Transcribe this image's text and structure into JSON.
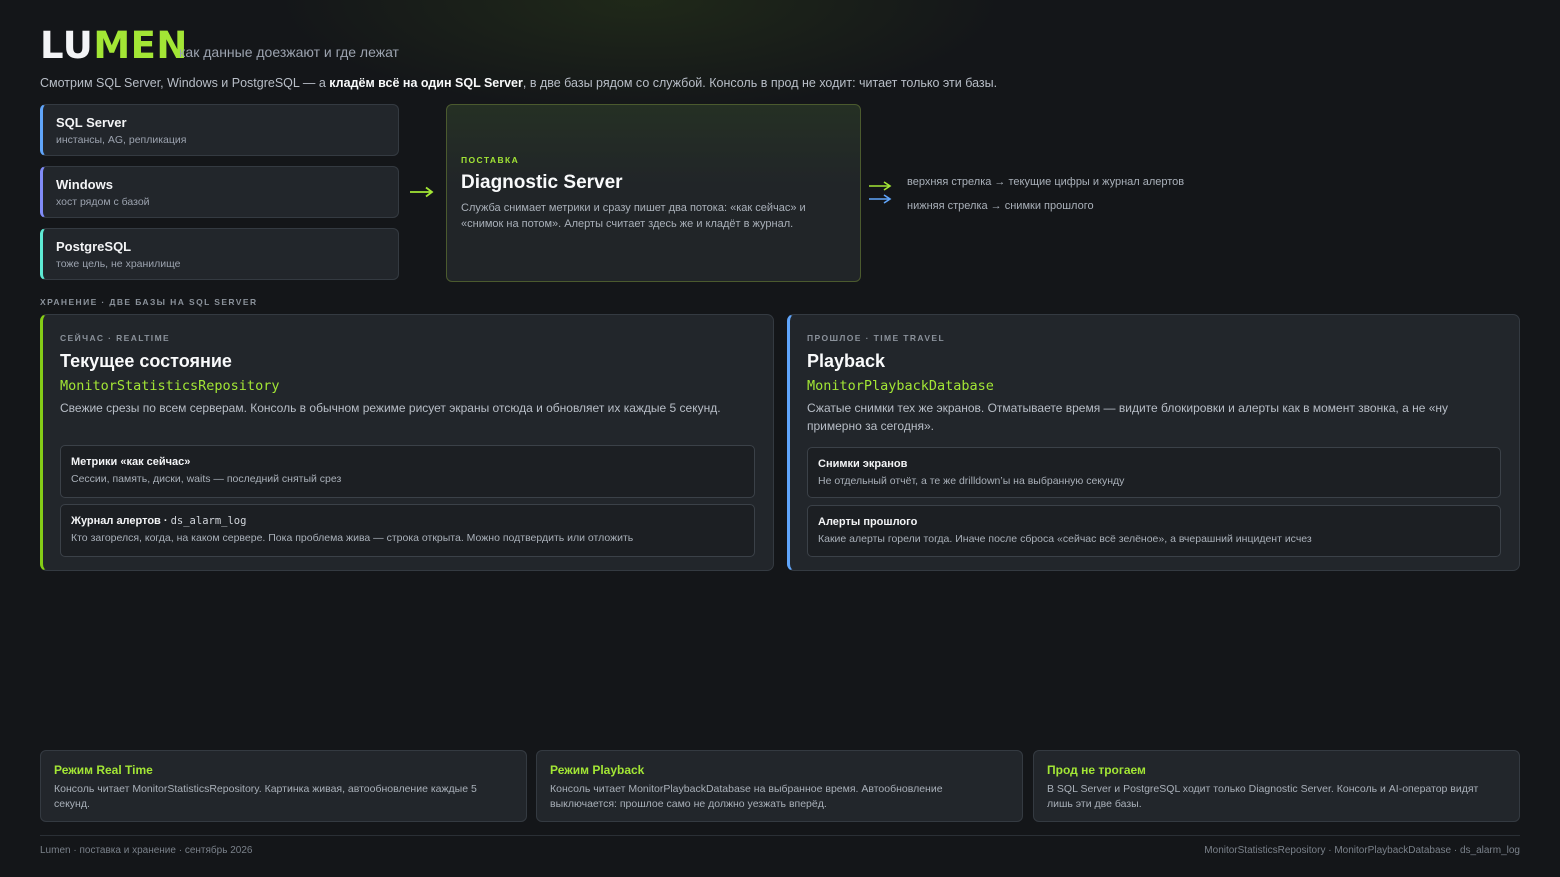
{
  "header": {
    "logo_part1": "LU",
    "logo_part2": "MEN",
    "tagline": "как данные доезжают и где лежат",
    "intro_prefix": "Смотрим SQL Server, Windows и PostgreSQL — а ",
    "intro_bold": "кладём всё на один SQL Server",
    "intro_suffix": ", в две базы рядом со службой. Консоль в прод не ходит: читает только эти базы."
  },
  "sources": [
    {
      "title": "SQL Server",
      "subtitle": "инстансы, AG, репликация",
      "accent": "#60a5fa"
    },
    {
      "title": "Windows",
      "subtitle": "хост рядом с базой",
      "accent": "#818cf8"
    },
    {
      "title": "PostgreSQL",
      "subtitle": "тоже цель, не хранилище",
      "accent": "#5eead4"
    }
  ],
  "delivery": {
    "kicker": "ПОСТАВКА",
    "title": "Diagnostic Server",
    "description": "Служба снимает метрики и сразу пишет два потока: «как сейчас» и «снимок на потом». Алерты считает здесь же и кладёт в журнал."
  },
  "legend": [
    {
      "text": "верхняя стрелка → текущие цифры и журнал алертов",
      "color": "#a3e635"
    },
    {
      "text": "нижняя стрелка → снимки прошлого",
      "color": "#60a5fa"
    }
  ],
  "storage_label": "ХРАНЕНИЕ · ДВЕ БАЗЫ НА SQL SERVER",
  "realtime": {
    "kicker": "СЕЙЧАС · REALTIME",
    "title": "Текущее состояние",
    "repo": "MonitorStatisticsRepository",
    "description": "Свежие срезы по всем серверам. Консоль в обычном режиме рисует экраны отсюда и обновляет их каждые 5 секунд.",
    "items": [
      {
        "title": "Метрики «как сейчас»",
        "code": "",
        "desc": "Сессии, память, диски, waits — последний снятый срез"
      },
      {
        "title": "Журнал алертов · ",
        "code": "ds_alarm_log",
        "desc": "Кто загорелся, когда, на каком сервере. Пока проблема жива — строка открыта. Можно подтвердить или отложить"
      }
    ],
    "accent": "#84cc16"
  },
  "playback": {
    "kicker": "ПРОШЛОЕ · TIME TRAVEL",
    "title": "Playback",
    "repo": "MonitorPlaybackDatabase",
    "description": "Сжатые снимки тех же экранов. Отматываете время — видите блокировки и алерты как в момент звонка, а не «ну примерно за сегодня».",
    "items": [
      {
        "title": "Снимки экранов",
        "desc": "Не отдельный отчёт, а те же drilldown’ы на выбранную секунду"
      },
      {
        "title": "Алерты прошлого",
        "desc": "Какие алерты горели тогда. Иначе после сброса «сейчас всё зелёное», а вчерашний инцидент исчез"
      }
    ],
    "accent": "#60a5fa"
  },
  "modes": [
    {
      "title": "Режим Real Time",
      "desc": "Консоль читает MonitorStatisticsRepository. Картинка живая, автообновление каждые 5 секунд."
    },
    {
      "title": "Режим Playback",
      "desc": "Консоль читает MonitorPlaybackDatabase на выбранное время. Автообновление выключается: прошлое само не должно уезжать вперёд."
    },
    {
      "title": "Прод не трогаем",
      "desc": "В SQL Server и PostgreSQL ходит только Diagnostic Server. Консоль и AI-оператор видят лишь эти две базы."
    }
  ],
  "footer": {
    "left": "Lumen · поставка и хранение · сентябрь 2026",
    "right": "MonitorStatisticsRepository · MonitorPlaybackDatabase · ds_alarm_log"
  }
}
